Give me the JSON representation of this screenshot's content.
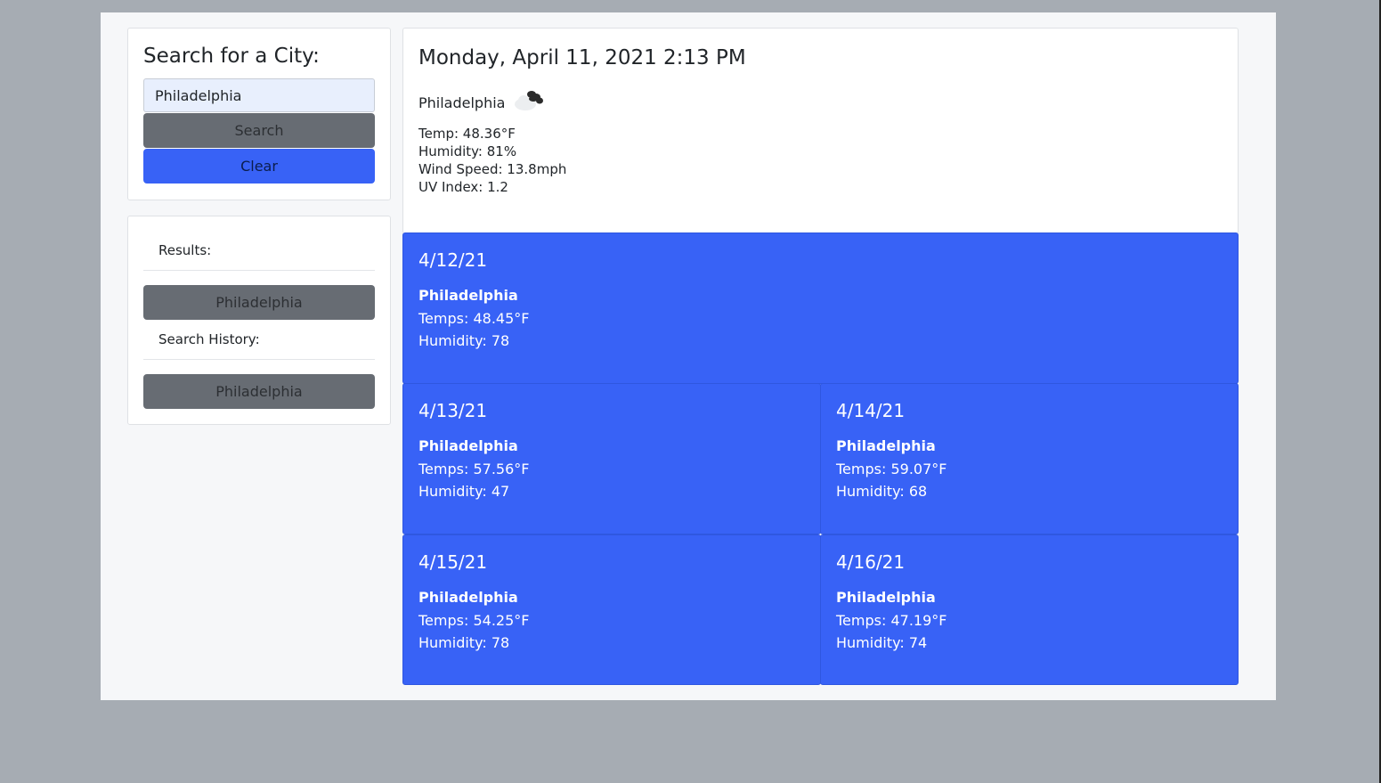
{
  "search": {
    "title": "Search for a City:",
    "input_value": "Philadelphia",
    "search_label": "Search",
    "clear_label": "Clear"
  },
  "results": {
    "results_label": "Results:",
    "result_button": "Philadelphia",
    "history_label": "Search History:",
    "history_button": "Philadelphia"
  },
  "current": {
    "datetime": "Monday, April 11, 2021 2:13 PM",
    "city": "Philadelphia",
    "icon": "cloud-icon",
    "temp": "Temp: 48.36°F",
    "humidity": "Humidity: 81%",
    "wind": "Wind Speed: 13.8mph",
    "uv": "UV Index: 1.2"
  },
  "forecast": [
    {
      "date": "4/12/21",
      "city": "Philadelphia",
      "temp": "Temps: 48.45°F",
      "humidity": "Humidity: 78"
    },
    {
      "date": "4/13/21",
      "city": "Philadelphia",
      "temp": "Temps: 57.56°F",
      "humidity": "Humidity: 47"
    },
    {
      "date": "4/14/21",
      "city": "Philadelphia",
      "temp": "Temps: 59.07°F",
      "humidity": "Humidity: 68"
    },
    {
      "date": "4/15/21",
      "city": "Philadelphia",
      "temp": "Temps: 54.25°F",
      "humidity": "Humidity: 78"
    },
    {
      "date": "4/16/21",
      "city": "Philadelphia",
      "temp": "Temps: 47.19°F",
      "humidity": "Humidity: 74"
    }
  ],
  "colors": {
    "accent": "#3862f6",
    "secondary": "#676c73",
    "backdrop": "#a6acb3"
  }
}
